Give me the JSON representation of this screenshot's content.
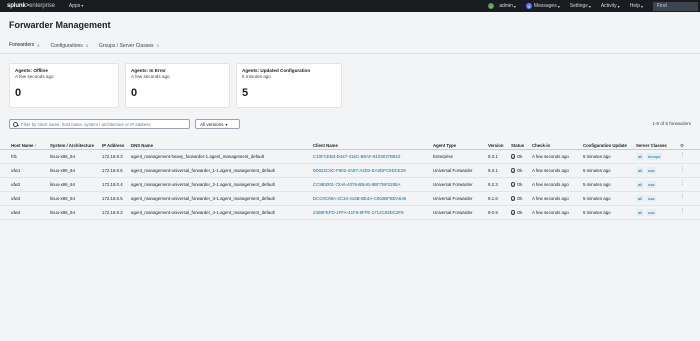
{
  "topbar": {
    "logo_bold": "splunk",
    "logo_sep": ">",
    "logo_light": "enterprise",
    "apps": "Apps",
    "user": "admin",
    "messages_count": "4",
    "messages": "Messages",
    "settings": "Settings",
    "activity": "Activity",
    "help": "Help",
    "find": "Find"
  },
  "page": {
    "title": "Forwarder Management"
  },
  "tabs": [
    {
      "label": "Forwarders",
      "count": "5"
    },
    {
      "label": "Configurations",
      "count": "3"
    },
    {
      "label": "Groups / Server Classes",
      "count": "3"
    }
  ],
  "cards": [
    {
      "title": "Agents: Offline",
      "sub": "A few seconds ago",
      "value": "0"
    },
    {
      "title": "Agents: In Error",
      "sub": "A few seconds ago",
      "value": "0"
    },
    {
      "title": "Agents: Updated Configuration",
      "sub": "5 minutes ago",
      "value": "5"
    }
  ],
  "filter": {
    "placeholder": "Filter by client name, host name, system / architecture or IP address"
  },
  "versions": {
    "selected": "All versions"
  },
  "range": "1-5 of 5 forwarders",
  "columns": [
    "Host Name ↑",
    "System / Architecture",
    "IP Address",
    "DNS Name",
    "Client Name",
    "Agent Type",
    "Version",
    "Status",
    "Check-in",
    "Configuration Update",
    "Server Classes"
  ],
  "rows": [
    {
      "host": "hf1",
      "arch": "linux-x86_64",
      "ip": "172.18.0.3",
      "dns": "agent_management-heavy_forwarder-1.agent_management_default",
      "client": "C10FCEB3-D447-415C-B8AF-8103037B810",
      "type": "Enterprise",
      "version": "9.3.1",
      "status": "Ok",
      "checkin": "A few seconds ago",
      "update": "5 minutes ago",
      "classes": [
        "all",
        "europe"
      ]
    },
    {
      "host": "ufw1",
      "arch": "linux-x86_64",
      "ip": "172.18.0.6",
      "dns": "agent_management-universal_forwarder_1-1.agent_management_default",
      "client": "0D022C0C-F802-4A87-A2D2-EA2DFC8DCE29",
      "type": "Universal Forwarder",
      "version": "9.3.1",
      "status": "Ok",
      "checkin": "A few seconds ago",
      "update": "5 minutes ago",
      "classes": [
        "all",
        "usa"
      ]
    },
    {
      "host": "ufw2",
      "arch": "linux-x86_64",
      "ip": "172.18.0.4",
      "dns": "agent_management-universal_forwarder_2-1.agent_management_default",
      "client": "CC983001-72A6-4078-BBAB-9BF7BF0285A",
      "type": "Universal Forwarder",
      "version": "9.2.3",
      "status": "Ok",
      "checkin": "A few seconds ago",
      "update": "5 minutes ago",
      "classes": [
        "all",
        "usa"
      ]
    },
    {
      "host": "ufw3",
      "arch": "linux-x86_64",
      "ip": "172.18.0.5",
      "dns": "agent_management-universal_forwarder_3-1.agent_management_default",
      "client": "DCC0C06A-2C34-416B-BE4A-C062BFBDA646",
      "type": "Universal Forwarder",
      "version": "9.1.6",
      "status": "Ok",
      "checkin": "A few seconds ago",
      "update": "5 minutes ago",
      "classes": [
        "all",
        "usa"
      ]
    },
    {
      "host": "ufw4",
      "arch": "linux-x86_64",
      "ip": "172.18.0.2",
      "dns": "agent_management-universal_forwarder_4-1.agent_management_default",
      "client": "240BFEFD-1FFA-41F6-8FFE-1712C93DC2F8",
      "type": "Universal Forwarder",
      "version": "9.0.9",
      "status": "Ok",
      "checkin": "A few seconds ago",
      "update": "5 minutes ago",
      "classes": [
        "all",
        "usa"
      ]
    }
  ]
}
